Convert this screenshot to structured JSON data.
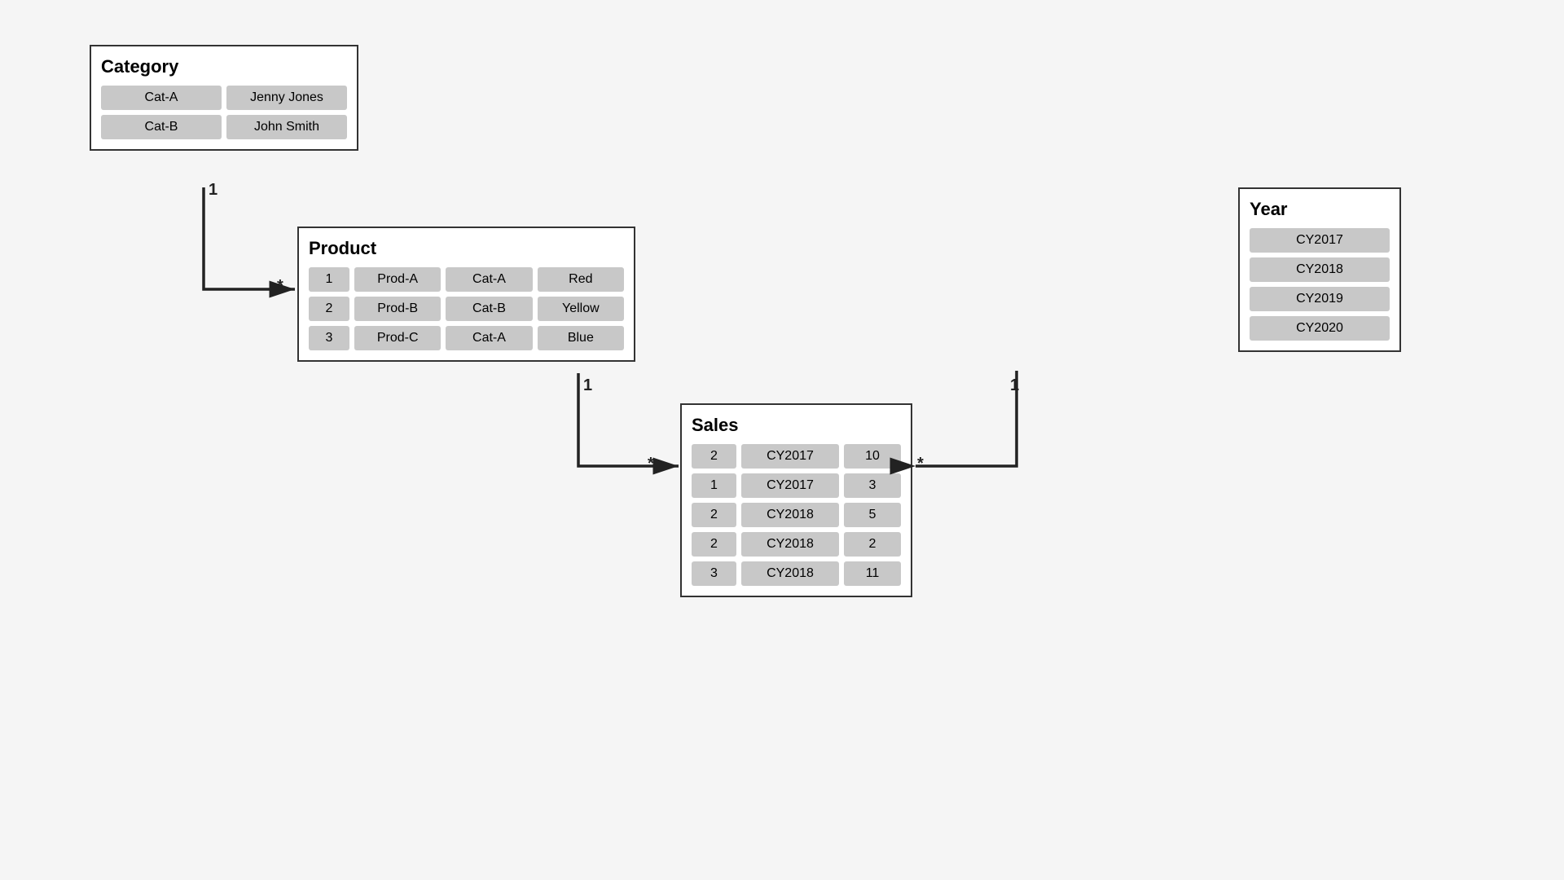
{
  "category": {
    "title": "Category",
    "rows": [
      [
        "Cat-A",
        "Jenny Jones"
      ],
      [
        "Cat-B",
        "John Smith"
      ]
    ]
  },
  "product": {
    "title": "Product",
    "rows": [
      [
        "1",
        "Prod-A",
        "Cat-A",
        "Red"
      ],
      [
        "2",
        "Prod-B",
        "Cat-B",
        "Yellow"
      ],
      [
        "3",
        "Prod-C",
        "Cat-A",
        "Blue"
      ]
    ]
  },
  "year": {
    "title": "Year",
    "rows": [
      [
        "CY2017"
      ],
      [
        "CY2018"
      ],
      [
        "CY2019"
      ],
      [
        "CY2020"
      ]
    ]
  },
  "sales": {
    "title": "Sales",
    "rows": [
      [
        "2",
        "CY2017",
        "10"
      ],
      [
        "1",
        "CY2017",
        "3"
      ],
      [
        "2",
        "CY2018",
        "5"
      ],
      [
        "2",
        "CY2018",
        "2"
      ],
      [
        "3",
        "CY2018",
        "11"
      ]
    ]
  },
  "relations": {
    "cat_prod": {
      "one": "1",
      "many": "*"
    },
    "prod_sales": {
      "one": "1",
      "many": "*"
    },
    "year_sales": {
      "one": "1",
      "many": "*"
    }
  }
}
